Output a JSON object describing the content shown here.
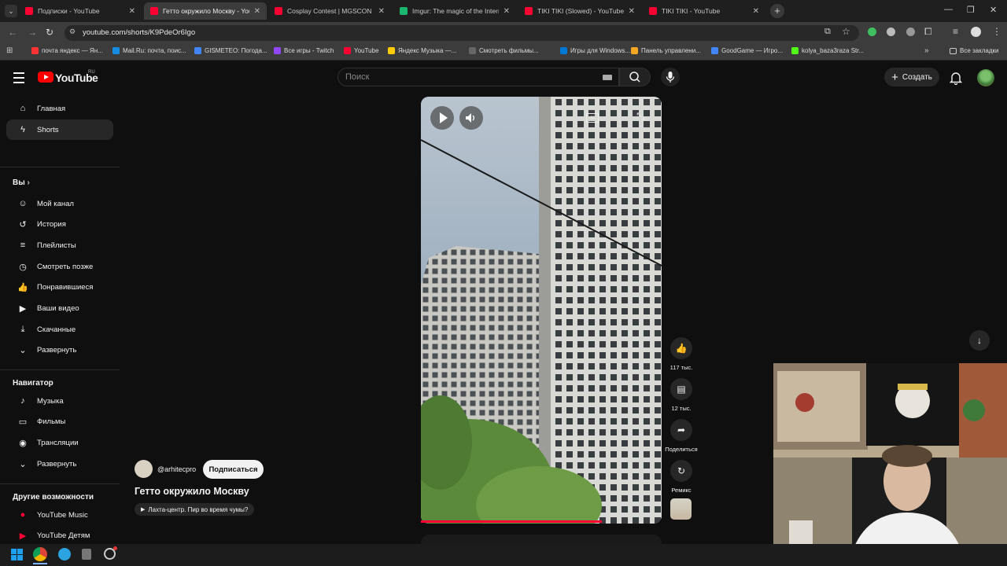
{
  "browser": {
    "tabs": [
      {
        "title": "Подписки - YouTube",
        "favicon_color": "#ff0033",
        "active": false
      },
      {
        "title": "Гетто окружило Москву - YouTube",
        "favicon_color": "#ff0033",
        "active": true
      },
      {
        "title": "Cosplay Contest | MGSCON 2024",
        "favicon_color": "#ff0033",
        "active": false
      },
      {
        "title": "Imgur: The magic of the Internet",
        "favicon_color": "#1bb76e",
        "active": false
      },
      {
        "title": "TIKI TIKI (Slowed) - YouTube",
        "favicon_color": "#ff0033",
        "active": false
      },
      {
        "title": "TIKI TIKI - YouTube",
        "favicon_color": "#ff0033",
        "active": false
      }
    ],
    "url": "youtube.com/shorts/K9PdeOr6Igo",
    "bookmarks": [
      {
        "label": "почта яндекс — Ян...",
        "color": "#ff3333"
      },
      {
        "label": "Mail.Ru: почта, поис...",
        "color": "#168de2"
      },
      {
        "label": "GISMETEO: Погода...",
        "color": "#4285f4"
      },
      {
        "label": "Все игры - Twitch",
        "color": "#9146ff"
      },
      {
        "label": "YouTube",
        "color": "#ff0033"
      },
      {
        "label": "Яндекс Музыка —...",
        "color": "#ffcc00"
      },
      {
        "label": "Смотреть фильмы...",
        "color": "#666666"
      },
      {
        "label": "Игры для Windows...",
        "color": "#0078d4"
      },
      {
        "label": "Панель управлени...",
        "color": "#f5a623"
      },
      {
        "label": "GoodGame — Игро...",
        "color": "#4285f4"
      },
      {
        "label": "kolya_baza3raza Str...",
        "color": "#53fc18"
      }
    ],
    "all_bookmarks": "Все закладки"
  },
  "header": {
    "logo": "YouTube",
    "region": "RU",
    "search_placeholder": "Поиск",
    "create_label": "Создать"
  },
  "sidebar": {
    "main": [
      {
        "label": "Главная",
        "icon": "home-icon",
        "glyph": "⌂"
      },
      {
        "label": "Shorts",
        "icon": "shorts-icon",
        "glyph": "ϟ"
      }
    ],
    "you_heading": "Вы",
    "you": [
      {
        "label": "Мой канал",
        "icon": "my-channel-icon",
        "glyph": "☺"
      },
      {
        "label": "История",
        "icon": "history-icon",
        "glyph": "↺"
      },
      {
        "label": "Плейлисты",
        "icon": "playlists-icon",
        "glyph": "≡"
      },
      {
        "label": "Смотреть позже",
        "icon": "watch-later-icon",
        "glyph": "◷"
      },
      {
        "label": "Понравившиеся",
        "icon": "like-icon",
        "glyph": "👍"
      },
      {
        "label": "Ваши видео",
        "icon": "your-videos-icon",
        "glyph": "▶"
      },
      {
        "label": "Скачанные",
        "icon": "download-icon",
        "glyph": "⤓"
      },
      {
        "label": "Развернуть",
        "icon": "chevron-down-icon",
        "glyph": "⌄"
      }
    ],
    "nav_heading": "Навигатор",
    "nav": [
      {
        "label": "Музыка",
        "icon": "music-icon",
        "glyph": "♪"
      },
      {
        "label": "Фильмы",
        "icon": "movies-icon",
        "glyph": "▭"
      },
      {
        "label": "Трансляции",
        "icon": "live-icon",
        "glyph": "◉"
      },
      {
        "label": "Развернуть",
        "icon": "chevron-down-icon",
        "glyph": "⌄"
      }
    ],
    "more_heading": "Другие возможности",
    "more": [
      {
        "label": "YouTube Music",
        "icon": "youtube-music-icon",
        "glyph": "●"
      },
      {
        "label": "YouTube Детям",
        "icon": "youtube-kids-icon",
        "glyph": "▶"
      }
    ]
  },
  "short": {
    "channel": "@arhitecpro",
    "subscribe": "Подписаться",
    "title": "Гетто окружило Москву",
    "sound": "Лахта-центр. Пир во время чумы?",
    "likes": "117 тыс.",
    "comments": "12 тыс.",
    "share": "Поделиться",
    "remix": "Ремикс",
    "progress": 0.75
  }
}
